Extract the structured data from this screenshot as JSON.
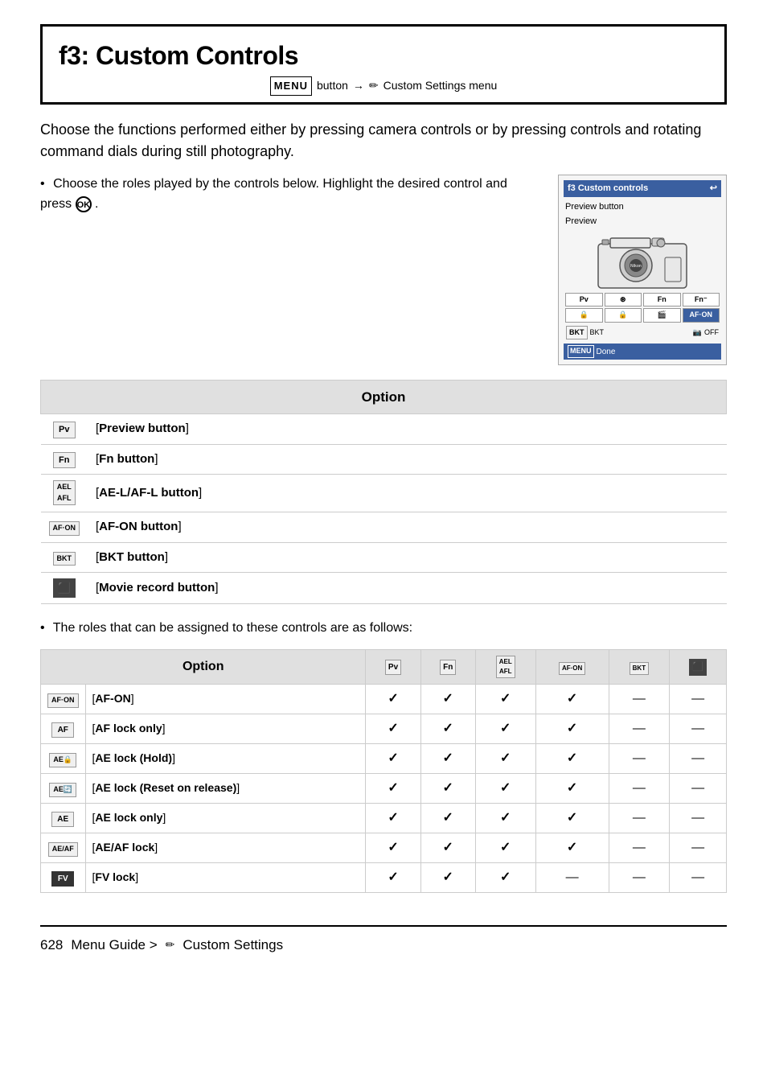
{
  "page": {
    "title": "f3: Custom Controls",
    "menu_path": {
      "menu_keyword": "MENU",
      "arrow": "→",
      "pencil": "✏",
      "rest": "Custom Settings menu"
    },
    "intro": "Choose the functions performed either by pressing camera controls or by pressing controls and rotating command dials during still photography.",
    "bullet1": "Choose the roles played by the controls below. Highlight the desired control and press ",
    "bullet1_ok": "⊛",
    "bullet2": "The roles that can be assigned to these controls are as follows:",
    "first_table": {
      "header": "Option",
      "rows": [
        {
          "icon": "Pv",
          "label": "[Preview button]",
          "dark": false
        },
        {
          "icon": "Fn",
          "label": "[Fn button]",
          "dark": false
        },
        {
          "icon": "AEL AFL",
          "label": "[AE-L/AF-L button]",
          "dark": false
        },
        {
          "icon": "AF·ON",
          "label": "[AF-ON button]",
          "dark": false
        },
        {
          "icon": "BKT",
          "label": "[BKT button]",
          "dark": false
        },
        {
          "icon": "🎬",
          "label": "[Movie record button]",
          "dark": true
        }
      ]
    },
    "second_table": {
      "header": "Option",
      "col_headers": [
        {
          "icon": "Pv",
          "dark": false
        },
        {
          "icon": "Fn",
          "dark": false
        },
        {
          "icon": "AEL AFL",
          "dark": false
        },
        {
          "icon": "AF·ON",
          "dark": false
        },
        {
          "icon": "BKT",
          "dark": false
        },
        {
          "icon": "🎬",
          "dark": true
        }
      ],
      "rows": [
        {
          "icon": "AF·ON",
          "dark": false,
          "label": "[AF-ON]",
          "checks": [
            true,
            true,
            true,
            true,
            false,
            false
          ]
        },
        {
          "icon": "AF",
          "dark": false,
          "label": "[AF lock only]",
          "checks": [
            true,
            true,
            true,
            true,
            false,
            false
          ]
        },
        {
          "icon": "AE🔒",
          "dark": false,
          "label": "[AE lock (Hold)]",
          "checks": [
            true,
            true,
            true,
            true,
            false,
            false
          ]
        },
        {
          "icon": "AE🔄",
          "dark": false,
          "label": "[AE lock (Reset on release)]",
          "checks": [
            true,
            true,
            true,
            true,
            false,
            false
          ]
        },
        {
          "icon": "AE",
          "dark": false,
          "label": "[AE lock only]",
          "checks": [
            true,
            true,
            true,
            true,
            false,
            false
          ]
        },
        {
          "icon": "AE/AF",
          "dark": false,
          "label": "[AE/AF lock]",
          "checks": [
            true,
            true,
            true,
            true,
            false,
            false
          ]
        },
        {
          "icon": "FV",
          "dark": false,
          "label": "[FV lock]",
          "checks": [
            true,
            true,
            true,
            false,
            false,
            false
          ]
        }
      ]
    },
    "footer": {
      "page_number": "628",
      "text": "Menu Guide >",
      "pencil": "✏",
      "section": "Custom Settings"
    }
  }
}
